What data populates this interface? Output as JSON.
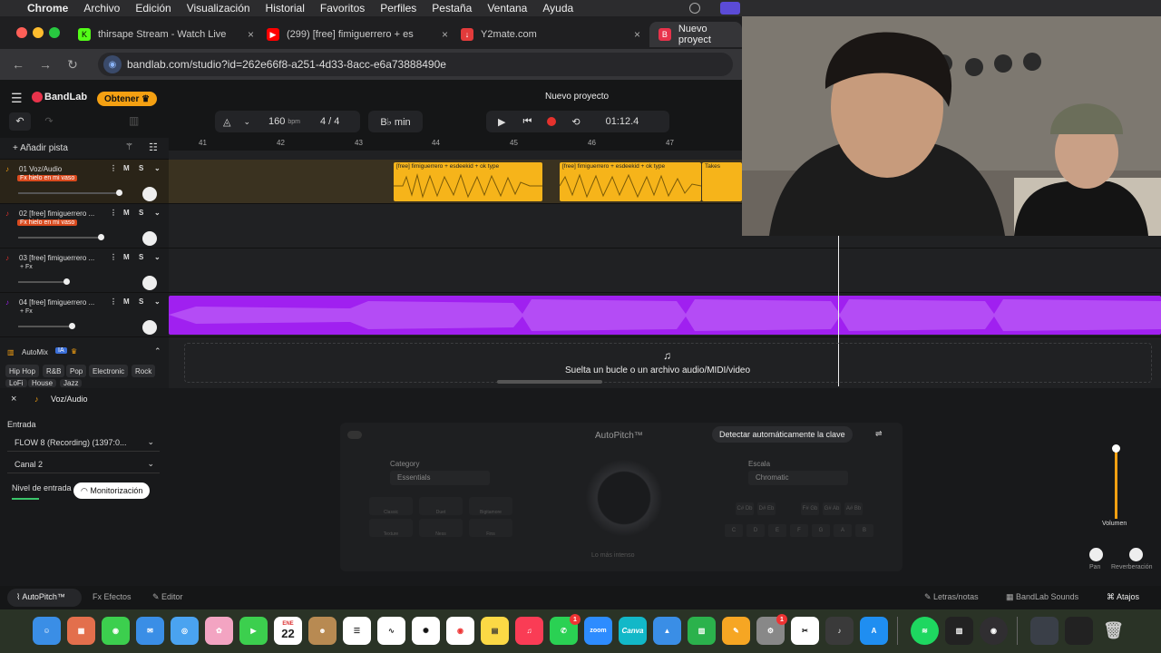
{
  "menubar": {
    "app": "Chrome",
    "items": [
      "Archivo",
      "Edición",
      "Visualización",
      "Historial",
      "Favoritos",
      "Perfiles",
      "Pestaña",
      "Ventana",
      "Ayuda"
    ]
  },
  "browser": {
    "tabs": [
      {
        "label": "thirsape Stream - Watch Live"
      },
      {
        "label": "(299) [free] fimiguerrero + es"
      },
      {
        "label": "Y2mate.com"
      },
      {
        "label": "Nuevo proyect"
      }
    ],
    "url": "bandlab.com/studio?id=262e66f8-a251-4d33-8acc-e6a73888490e"
  },
  "bandlab": {
    "logo": "BandLab",
    "obtener": "Obtener",
    "project_title": "Nuevo proyecto",
    "bpm_value": "160",
    "bpm_unit": "bpm",
    "time_sig": "4 / 4",
    "key": "B♭ min",
    "time": "01:12.4",
    "add_track": "Añadir pista",
    "ruler": [
      "41",
      "42",
      "43",
      "44",
      "45",
      "46",
      "47"
    ],
    "tracks": [
      {
        "num": "01",
        "name": "Voz/Audio",
        "fx": "Fx hielo en mi vaso",
        "m": "M",
        "s": "S"
      },
      {
        "num": "02",
        "name": "[free] fimiguerrero ...",
        "fx": "Fx hielo en mi vaso",
        "m": "M",
        "s": "S"
      },
      {
        "num": "03",
        "name": "[free] fimiguerrero ...",
        "fx": "+ Fx",
        "m": "M",
        "s": "S"
      },
      {
        "num": "04",
        "name": "[free] fimiguerrero ...",
        "fx": "+ Fx",
        "m": "M",
        "s": "S"
      }
    ],
    "clips": [
      {
        "label": "[free] fimiguerrero + esdeekid + ok type"
      },
      {
        "label": "[free] fimiguerrero + esdeekid + ok type"
      },
      {
        "label": "Takes"
      }
    ],
    "automix": {
      "title": "AutoMix",
      "ia": "IA",
      "genres": [
        "Hip Hop",
        "R&B",
        "Pop",
        "Electronic",
        "Rock",
        "LoFi",
        "House",
        "Jazz"
      ]
    },
    "drop_text": "Suelta un bucle o un archivo audio/MIDI/video",
    "editor": {
      "track_name": "Voz/Audio",
      "entrada_label": "Entrada",
      "input_device": "FLOW 8 (Recording) (1397:0...",
      "channel": "Canal 2",
      "level_label": "Nivel de entrada",
      "monitor_btn": "Monitorización",
      "autopitch_title": "AutoPitch™",
      "detect_btn": "Detectar automáticamente la clave",
      "category_label": "Category",
      "category_value": "Essentials",
      "scale_label": "Escala",
      "scale_value": "Chromatic",
      "knob_caption": "Lo más intenso",
      "tiles": [
        "Classic",
        "Duet",
        "Bigitamore",
        "Texture",
        "Ness",
        "Fins"
      ],
      "scale_keys_top": [
        "C#\nDb",
        "D#\nEb",
        "F#\nGb",
        "G#\nAb",
        "A#\nBb"
      ],
      "scale_keys": [
        "C",
        "D",
        "E",
        "F",
        "G",
        "A",
        "B"
      ],
      "volume_label": "Volumen",
      "pan_label": "Pan",
      "reverb_label": "Reverberación"
    },
    "footer": {
      "autopitch": "AutoPitch™",
      "efectos": "Efectos",
      "editor": "Editor",
      "letras": "Letras/notas",
      "sounds": "BandLab Sounds",
      "atajos": "Atajos"
    }
  },
  "dock": {
    "calendar_month": "ENE",
    "calendar_day": "22",
    "badges": [
      "1",
      "1"
    ],
    "zoom": "zoom",
    "canva": "Canva"
  },
  "colors": {
    "accent_orange": "#f4a012",
    "audio_clip": "#f6b41a",
    "purple_clip": "#a020f0",
    "record": "#e5322d"
  }
}
